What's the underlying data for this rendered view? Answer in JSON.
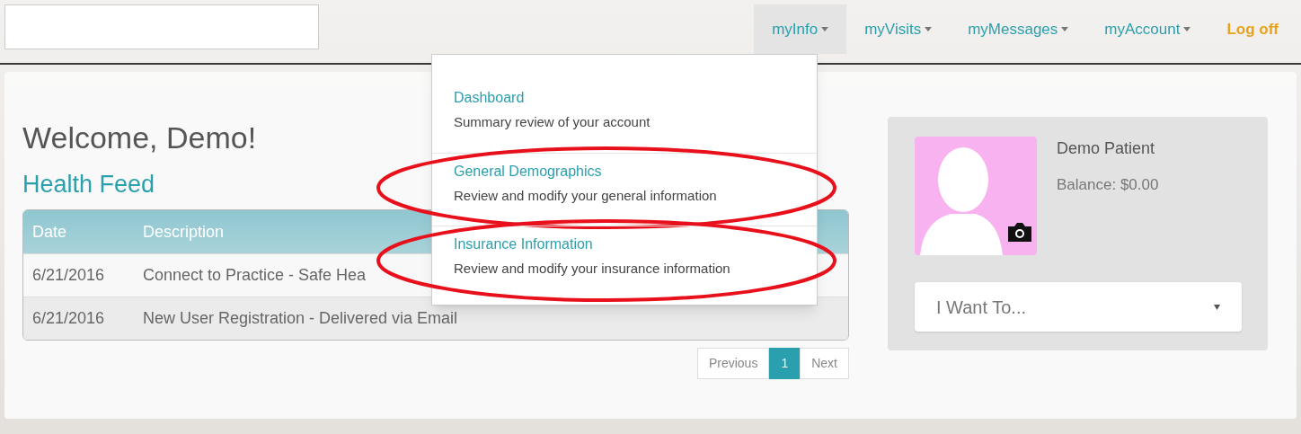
{
  "nav": {
    "items": [
      {
        "label": "myInfo",
        "selected": true,
        "kind": "menu"
      },
      {
        "label": "myVisits",
        "selected": false,
        "kind": "menu"
      },
      {
        "label": "myMessages",
        "selected": false,
        "kind": "menu"
      },
      {
        "label": "myAccount",
        "selected": false,
        "kind": "menu"
      },
      {
        "label": "Log off",
        "selected": false,
        "kind": "link"
      }
    ],
    "menu": {
      "items": [
        {
          "title": "Dashboard",
          "description": "Summary review of your account",
          "highlighted": false
        },
        {
          "title": "General Demographics",
          "description": "Review and modify your general information",
          "highlighted": true
        },
        {
          "title": "Insurance Information",
          "description": "Review and modify your insurance information",
          "highlighted": true
        }
      ]
    }
  },
  "welcome": "Welcome, Demo!",
  "health_feed": {
    "title": "Health Feed",
    "columns": [
      "Date",
      "Description"
    ],
    "rows": [
      {
        "date": "6/21/2016",
        "description": "Connect to Practice - Safe Hea"
      },
      {
        "date": "6/21/2016",
        "description": "New User Registration - Delivered via Email"
      }
    ],
    "pagination": [
      {
        "label": "Previous",
        "selected": false
      },
      {
        "label": "1",
        "selected": true
      },
      {
        "label": "Next",
        "selected": false
      }
    ]
  },
  "profile": {
    "name": "Demo Patient",
    "balance": "Balance: $0.00",
    "action_select": {
      "value": "I Want To..."
    }
  }
}
